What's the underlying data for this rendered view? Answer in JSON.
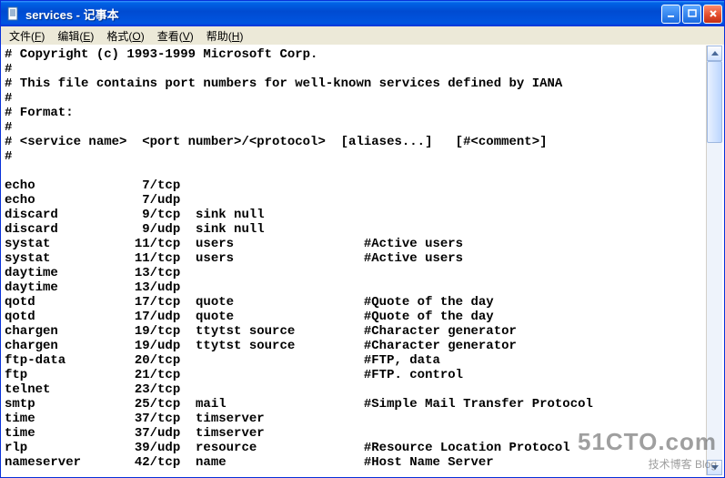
{
  "window": {
    "title": "services - 记事本"
  },
  "menu": {
    "file": {
      "label": "文件",
      "key": "F"
    },
    "edit": {
      "label": "编辑",
      "key": "E"
    },
    "format": {
      "label": "格式",
      "key": "O"
    },
    "view": {
      "label": "查看",
      "key": "V"
    },
    "help": {
      "label": "帮助",
      "key": "H"
    }
  },
  "content": {
    "header_lines": [
      "# Copyright (c) 1993-1999 Microsoft Corp.",
      "#",
      "# This file contains port numbers for well-known services defined by IANA",
      "#",
      "# Format:",
      "#",
      "# <service name>  <port number>/<protocol>  [aliases...]   [#<comment>]",
      "#",
      ""
    ],
    "services": [
      {
        "name": "echo",
        "port": "7/tcp",
        "aliases": "",
        "comment": ""
      },
      {
        "name": "echo",
        "port": "7/udp",
        "aliases": "",
        "comment": ""
      },
      {
        "name": "discard",
        "port": "9/tcp",
        "aliases": "sink null",
        "comment": ""
      },
      {
        "name": "discard",
        "port": "9/udp",
        "aliases": "sink null",
        "comment": ""
      },
      {
        "name": "systat",
        "port": "11/tcp",
        "aliases": "users",
        "comment": "Active users"
      },
      {
        "name": "systat",
        "port": "11/tcp",
        "aliases": "users",
        "comment": "Active users"
      },
      {
        "name": "daytime",
        "port": "13/tcp",
        "aliases": "",
        "comment": ""
      },
      {
        "name": "daytime",
        "port": "13/udp",
        "aliases": "",
        "comment": ""
      },
      {
        "name": "qotd",
        "port": "17/tcp",
        "aliases": "quote",
        "comment": "Quote of the day"
      },
      {
        "name": "qotd",
        "port": "17/udp",
        "aliases": "quote",
        "comment": "Quote of the day"
      },
      {
        "name": "chargen",
        "port": "19/tcp",
        "aliases": "ttytst source",
        "comment": "Character generator"
      },
      {
        "name": "chargen",
        "port": "19/udp",
        "aliases": "ttytst source",
        "comment": "Character generator"
      },
      {
        "name": "ftp-data",
        "port": "20/tcp",
        "aliases": "",
        "comment": "FTP, data"
      },
      {
        "name": "ftp",
        "port": "21/tcp",
        "aliases": "",
        "comment": "FTP. control"
      },
      {
        "name": "telnet",
        "port": "23/tcp",
        "aliases": "",
        "comment": ""
      },
      {
        "name": "smtp",
        "port": "25/tcp",
        "aliases": "mail",
        "comment": "Simple Mail Transfer Protocol"
      },
      {
        "name": "time",
        "port": "37/tcp",
        "aliases": "timserver",
        "comment": ""
      },
      {
        "name": "time",
        "port": "37/udp",
        "aliases": "timserver",
        "comment": ""
      },
      {
        "name": "rlp",
        "port": "39/udp",
        "aliases": "resource",
        "comment": "Resource Location Protocol"
      },
      {
        "name": "nameserver",
        "port": "42/tcp",
        "aliases": "name",
        "comment": "Host Name Server"
      }
    ],
    "columns": {
      "name_w": 14,
      "port_w": 11,
      "alias_w": 22
    }
  },
  "watermark": {
    "big": "51CTO.com",
    "small": "技术博客   Blog"
  }
}
